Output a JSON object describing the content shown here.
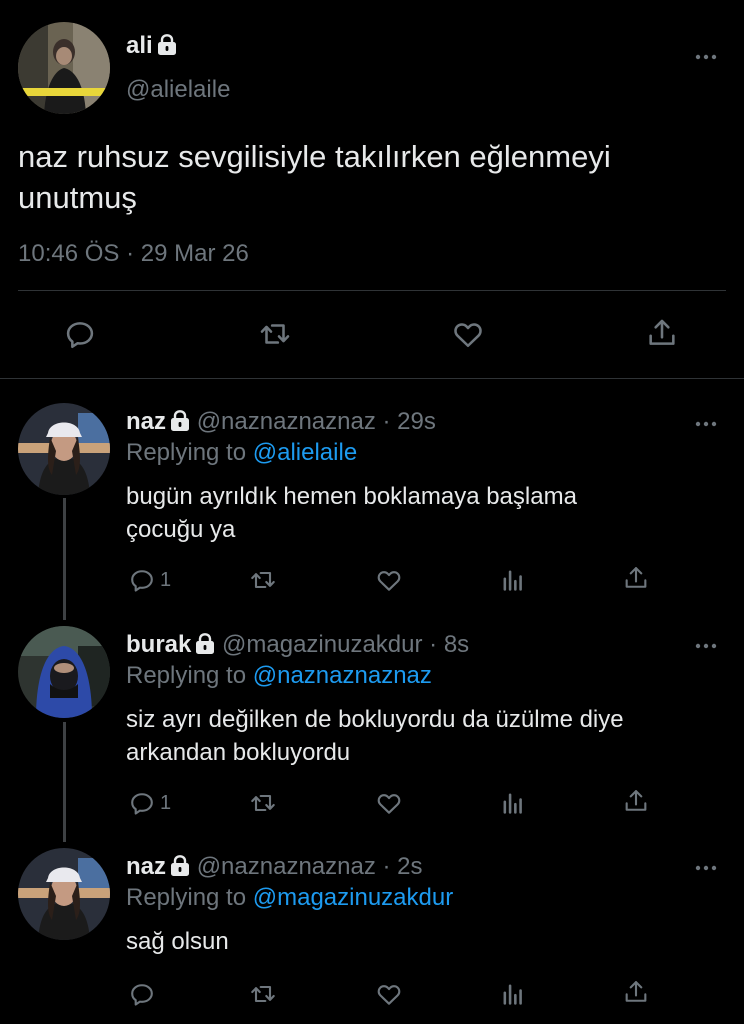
{
  "main_tweet": {
    "name": "ali",
    "handle": "@alielaile",
    "text_line1": "naz ruhsuz sevgilisiyle takılırken eğlenmeyi",
    "text_line2": "unutmuş",
    "time": "10:46 ÖS",
    "separator": "·",
    "date": "29 Mar 26"
  },
  "replies": [
    {
      "name": "naz",
      "handle": "@naznaznaznaz",
      "time": "· 29s",
      "replying_prefix": "Replying to",
      "replying_to": "@alielaile",
      "text_line1": "bugün ayrıldık hemen boklamaya başlama",
      "text_line2": "çocuğu ya",
      "reply_count": "1"
    },
    {
      "name": "burak",
      "handle": "@magazinuzakdur",
      "time": "· 8s",
      "replying_prefix": "Replying to",
      "replying_to": "@naznaznaznaz",
      "text_line1": "siz ayrı değilken de bokluyordu da üzülme diye",
      "text_line2": "arkandan bokluyordu",
      "reply_count": "1"
    },
    {
      "name": "naz",
      "handle": "@naznaznaznaz",
      "time": "· 2s",
      "replying_prefix": "Replying to",
      "replying_to": "@magazinuzakdur",
      "text_line1": "sağ olsun",
      "text_line2": "",
      "reply_count": ""
    }
  ],
  "colors": {
    "background": "#000000",
    "text": "#e7e9ea",
    "muted": "#6e767d",
    "link": "#1d9bf0",
    "divider": "#2f3336"
  },
  "icons": [
    "lock-icon",
    "more-icon",
    "reply-icon",
    "retweet-icon",
    "like-icon",
    "share-icon",
    "analytics-icon"
  ]
}
